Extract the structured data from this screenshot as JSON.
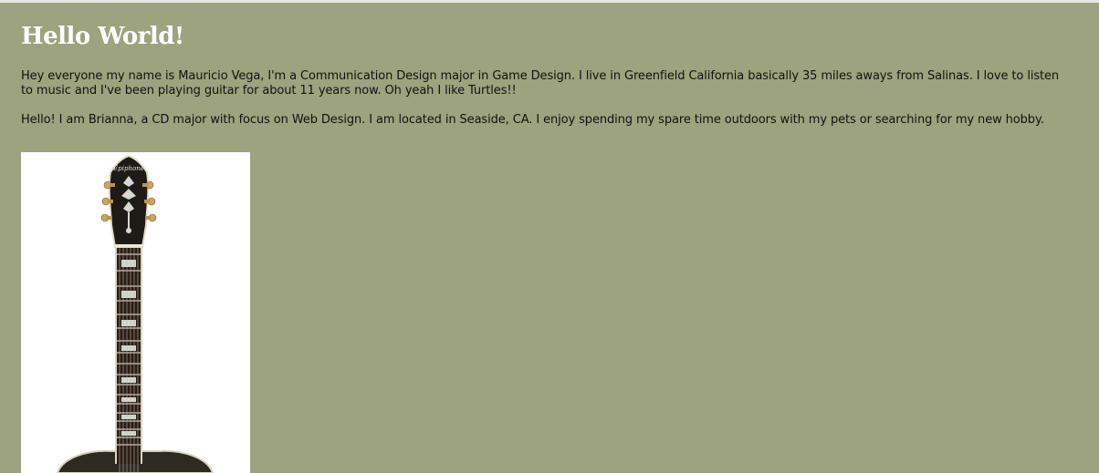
{
  "page": {
    "heading": "Hello World!",
    "paragraphs": [
      "Hey everyone my name is Mauricio Vega, I'm a Communication Design major in Game Design. I live in Greenfield California basically 35 miles aways from Salinas. I love to listen to music and I've been playing guitar for about 11 years now. Oh yeah I like Turtles!!",
      "Hello! I am Brianna, a CD major with focus on Web Design. I am located in Seaside, CA. I enjoy spending my spare time outdoors with my pets or searching for my new hobby."
    ],
    "image": {
      "alt": "Epiphone hollow-body electric guitar",
      "headstock_text": "Epiphone"
    }
  },
  "colors": {
    "background": "#9ca37e",
    "heading": "#ffffff",
    "text": "#111111"
  }
}
